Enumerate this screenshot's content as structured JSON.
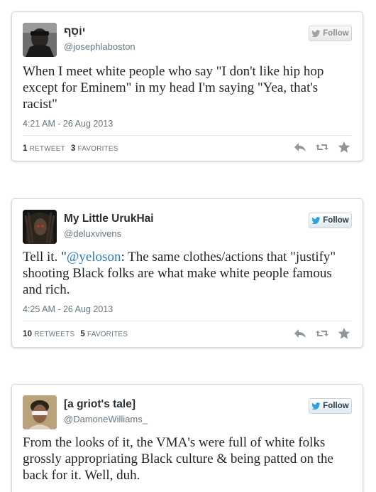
{
  "tweets": [
    {
      "display_name": "יוֹסֵף",
      "screen_name": "@josephlaboston",
      "follow_label": "Follow",
      "text": "When I meet white people who say \"I don't like hip hop except for Eminem\" in my head I'm saying \"Yea, that's racist\"",
      "timestamp": "4:21 AM - 26 Aug 2013",
      "retweets_count": "1",
      "retweets_label": "RETWEET",
      "favorites_count": "3",
      "favorites_label": "FAVORITES"
    },
    {
      "display_name": "My Little UrukHai",
      "screen_name": "@deluxvivens",
      "follow_label": "Follow",
      "text_prefix": "Tell it. \"",
      "mention": "@yeloson",
      "text_suffix": ": The same clothes/actions that \"justify\" shooting Black folks are what make white people famous and rich.",
      "timestamp": "4:25 AM - 26 Aug 2013",
      "retweets_count": "10",
      "retweets_label": "RETWEETS",
      "favorites_count": "5",
      "favorites_label": "FAVORITES"
    },
    {
      "display_name": "[a griot's tale]",
      "screen_name": "@DamoneWilliams_",
      "follow_label": "Follow",
      "text": "From the looks of it, the VMA's were full of white folks grossly appropriating Black culture & being patted on the back for it. Well, duh."
    }
  ],
  "icons": {
    "follow": "twitter-bird-icon",
    "reply": "reply-icon",
    "retweet": "retweet-icon",
    "favorite": "star-icon"
  },
  "colors": {
    "bird_blue": "#2ba0e0",
    "bird_gray": "#9aa3a8",
    "mention_blue": "#2b7bb9",
    "action_gray": "#8f969b"
  }
}
